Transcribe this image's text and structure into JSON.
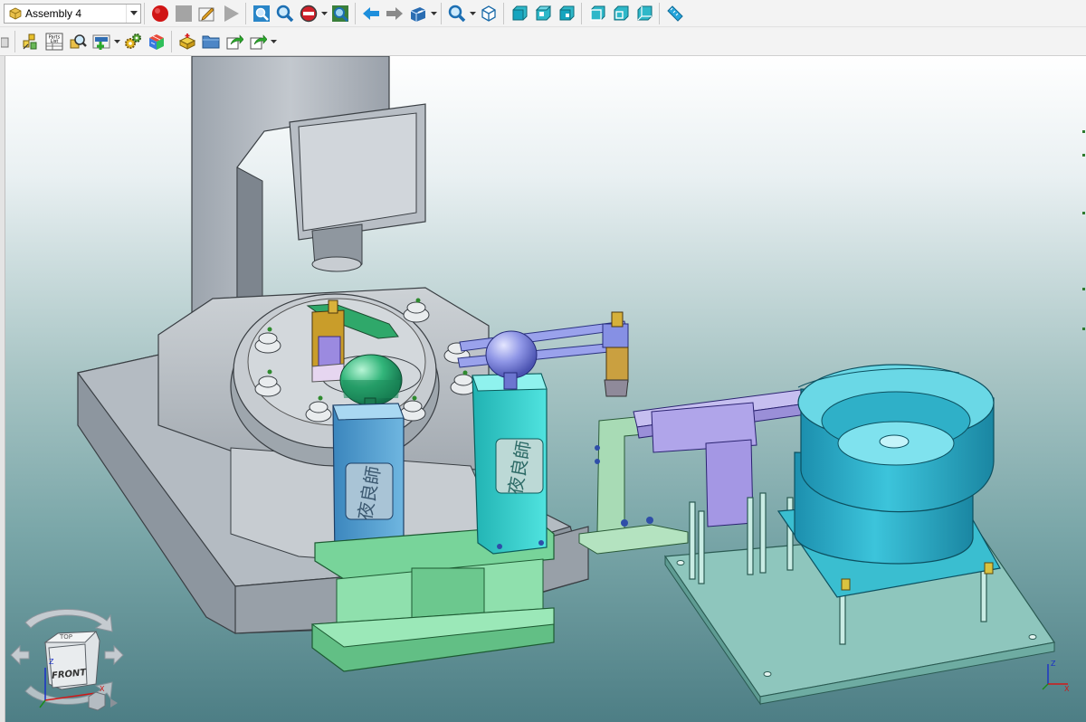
{
  "toolbar1": {
    "assembly_selector": {
      "value": "Assembly 4",
      "icon": "assembly-icon"
    },
    "icons": [
      "record-icon",
      "stop-icon",
      "edit-icon",
      "play-icon",
      "zoom-window-icon",
      "zoom-icon",
      "no-entry-icon",
      "zoom-fit-icon",
      "back-arrow-icon",
      "forward-arrow-icon",
      "box-view-icon",
      "zoom-options-icon",
      "iso-cube-icon",
      "front-view-icon",
      "top-view-icon",
      "right-view-icon",
      "wireframe-cube-icon",
      "hidden-lines-cube-icon",
      "shaded-cube-icon",
      "measure-ruler-icon"
    ]
  },
  "toolbar2": {
    "parts_list_label": "Parts\nList",
    "icons": [
      "eraser-icon",
      "explode-icon",
      "parts-list-icon",
      "find-part-icon",
      "insert-component-icon",
      "gears-icon",
      "color-cube-icon",
      "new-part-icon",
      "open-folder-icon",
      "export-icon",
      "publish-icon"
    ]
  },
  "viewport": {
    "part_plaque_text": "夜良師",
    "viewcube": {
      "face_label": "FRONT",
      "top_label": "TOP",
      "axis_labels": {
        "z": "Z",
        "x": "X"
      }
    },
    "triad": {
      "z": "Z",
      "x": "X"
    },
    "colors": {
      "frame": "#aab0b8",
      "base_plate": "#a9b3bd",
      "rotary_table": "#c3c8cc",
      "fixture_green": "#7ed6a0",
      "blue_column": "#5aa8d6",
      "cyan_column": "#33d3cf",
      "feeder_bowl": "#2fb2cc",
      "linear_track": "#a79ae0",
      "feeder_plate": "#86c9bf",
      "bracket": "#9ad2aa"
    }
  }
}
